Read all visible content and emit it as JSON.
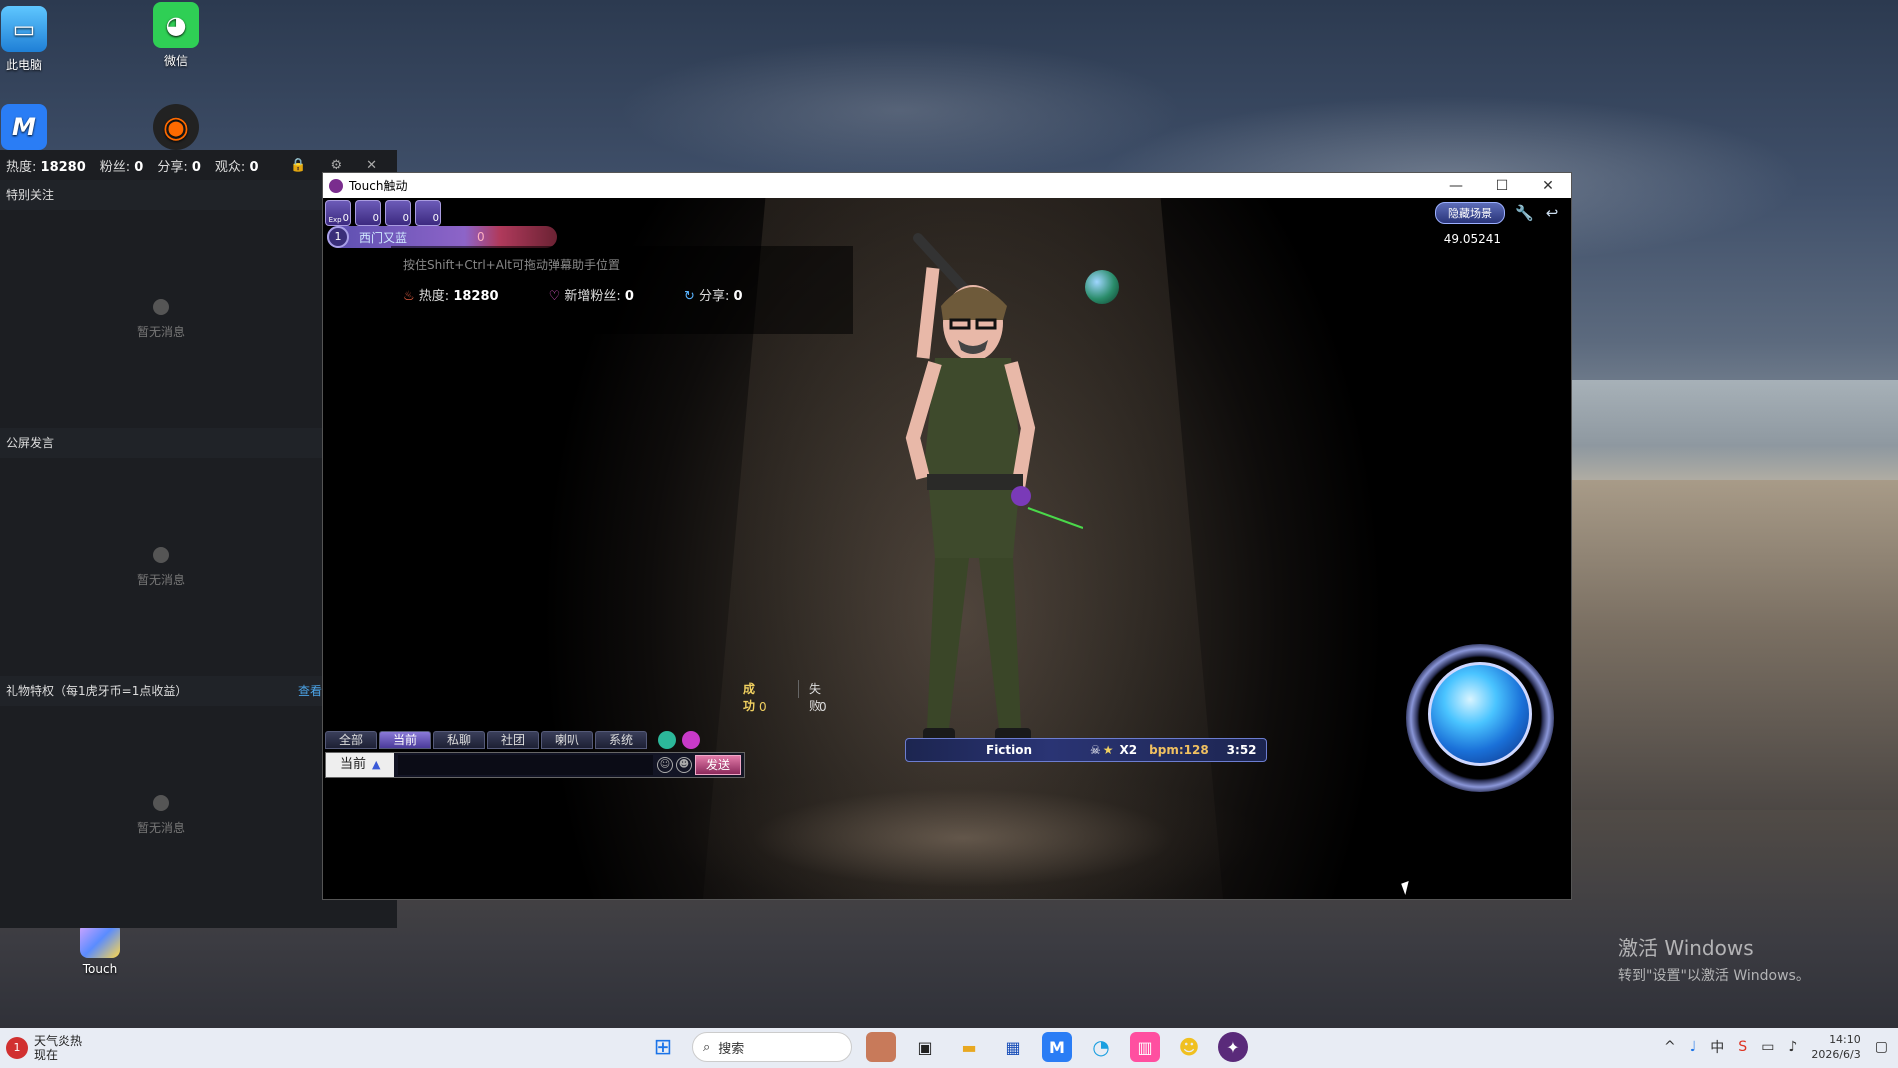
{
  "desktop": {
    "icons": [
      {
        "label": "此电脑",
        "icon": "computer-icon"
      },
      {
        "label": "微信",
        "icon": "wechat-icon"
      },
      {
        "label": "",
        "icon": "app-m-icon"
      },
      {
        "label": "",
        "icon": "obs-icon"
      },
      {
        "label": "Touch",
        "icon": "touch-game-icon"
      }
    ],
    "watermark_title": "激活 Windows",
    "watermark_sub": "转到\"设置\"以激活 Windows。"
  },
  "side_panel": {
    "stats": {
      "heat_label": "热度:",
      "heat_value": "18280",
      "fans_label": "粉丝:",
      "fans_value": "0",
      "share_label": "分享:",
      "share_value": "0",
      "viewers_label": "观众:",
      "viewers_value": "0"
    },
    "sections": [
      {
        "title": "特别关注",
        "empty_text": "暂无消息"
      },
      {
        "title": "公屏发言",
        "empty_text": "暂无消息"
      },
      {
        "title": "礼物特权（每1虎牙币=1点收益）",
        "empty_text": "暂无消息",
        "link": "查看"
      }
    ]
  },
  "game_window": {
    "title": "Touch触动",
    "controls": [
      "—",
      "☐",
      "✕"
    ],
    "badges": [
      "0",
      "0",
      "0",
      "0"
    ],
    "badge_first_label": "Exp",
    "player": {
      "level": "1",
      "name": "西门又蓝",
      "score": "0"
    },
    "hint": "按住Shift+Ctrl+Alt可拖动弹幕助手位置",
    "stats": {
      "heat_label": "热度:",
      "heat_value": "18280",
      "fans_label": "新增粉丝:",
      "fans_value": "0",
      "share_label": "分享:",
      "share_value": "0"
    },
    "hide_scene_label": "隐藏场景",
    "timer": "49.05241",
    "hits": {
      "success_label": "成功",
      "success_value": "0",
      "fail_label": "失败",
      "fail_value": "0"
    },
    "music": {
      "song": "Fiction",
      "multiplier": "X2",
      "bpm": "bpm:128",
      "time": "3:52"
    },
    "chat_tabs": [
      "全部",
      "当前",
      "私聊",
      "社团",
      "喇叭",
      "系统"
    ],
    "active_tab": "当前",
    "chat_channel": "当前",
    "send_label": "发送"
  },
  "taskbar": {
    "weather_title": "天气炎热",
    "weather_sub": "现在",
    "weather_badge": "1",
    "search_placeholder": "搜索",
    "time": "14:10",
    "date": "2026/6/3"
  },
  "colors": {
    "accent": "#5b4fb0",
    "send": "#e17aa8",
    "orb": "#4ac4ff"
  }
}
